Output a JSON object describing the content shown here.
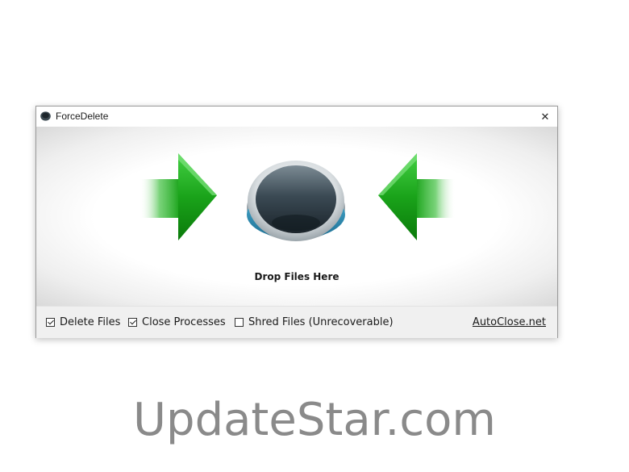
{
  "window": {
    "title": "ForceDelete",
    "app_icon": "disc-icon",
    "close_icon": "close-icon",
    "close_symbol": "✕"
  },
  "drop_area": {
    "label": "Drop Files Here",
    "left_arrow_icon": "arrow-right-icon",
    "right_arrow_icon": "arrow-left-icon",
    "center_icon": "drop-hole-icon",
    "arrow_color": "#1aa31a"
  },
  "options": {
    "delete_files": {
      "label": "Delete Files",
      "checked": true
    },
    "close_processes": {
      "label": "Close Processes",
      "checked": true
    },
    "shred_files": {
      "label": "Shred Files (Unrecoverable)",
      "checked": false
    }
  },
  "link": {
    "label": "AutoClose.net"
  },
  "watermark": {
    "text": "UpdateStar.com"
  }
}
